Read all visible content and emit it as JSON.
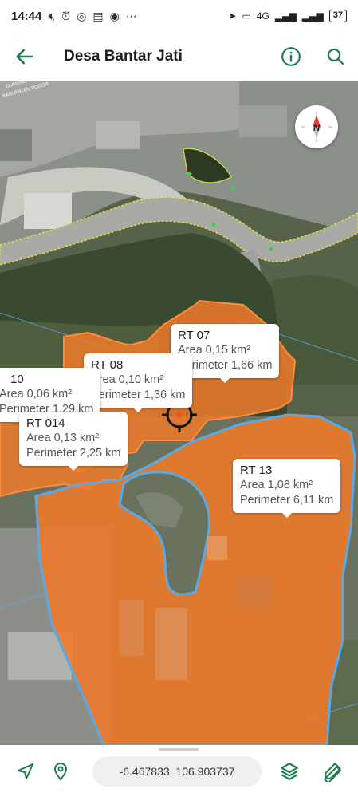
{
  "status": {
    "time": "14:44",
    "network": "4G",
    "battery": "37"
  },
  "app_bar": {
    "title": "Desa Bantar Jati",
    "back_icon": "arrow-left-icon",
    "info_icon": "info-icon",
    "search_icon": "search-icon"
  },
  "map": {
    "labels": [
      {
        "name": "RT 07",
        "area": "Area 0,15 km²",
        "perimeter": "Perimeter 1,66 km"
      },
      {
        "name": "RT 08",
        "area": "Area 0,10 km²",
        "perimeter": "Perimeter 1,36 km"
      },
      {
        "name": "10",
        "area": "Area 0,06 km²",
        "perimeter": "Perimeter 1,29 km"
      },
      {
        "name": "RT 014",
        "area": "Area 0,13 km²",
        "perimeter": "Perimeter 2,25 km"
      },
      {
        "name": "RT 13",
        "area": "Area 1,08 km²",
        "perimeter": "Perimeter 6,11 km"
      }
    ],
    "road_labels": [
      "KABUPATEN BOGOR",
      "GUNUNG PUTRI"
    ],
    "colors": {
      "polygon_fill": "#f07a2a",
      "polygon_stroke": "#ff8c3a",
      "selected_stroke": "#5aa9e6",
      "boundary": "#d8e04a"
    }
  },
  "bottom_bar": {
    "coordinates": "-6.467833, 106.903737",
    "navigate_icon": "navigation-arrow-icon",
    "location_icon": "location-pin-icon",
    "layers_icon": "layers-icon",
    "measure_icon": "ruler-pencil-icon"
  },
  "accent_color": "#1e7d4f"
}
